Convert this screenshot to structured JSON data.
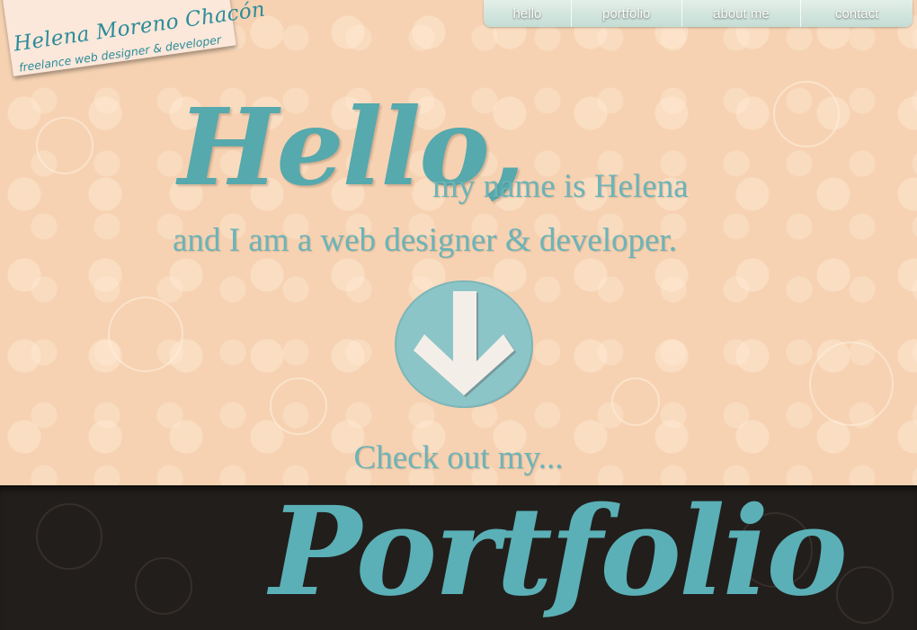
{
  "logo": {
    "name": "Helena Moreno Chacón",
    "tagline": "freelance web designer & developer"
  },
  "nav": {
    "items": [
      {
        "label": "hello"
      },
      {
        "label": "portfolio"
      },
      {
        "label": "about me"
      },
      {
        "label": "contact"
      }
    ]
  },
  "hero": {
    "hello": "Hello,",
    "line1": "my name is Helena",
    "line2": "and I am a web designer & developer.",
    "scroll_icon": "down-arrow-icon",
    "checkout": "Check out my..."
  },
  "section": {
    "title": "Portfolio"
  },
  "colors": {
    "peach": "#f6d2b2",
    "teal": "#5ab0b6",
    "dark": "#221e1c",
    "nav": "#c3ddd4"
  }
}
